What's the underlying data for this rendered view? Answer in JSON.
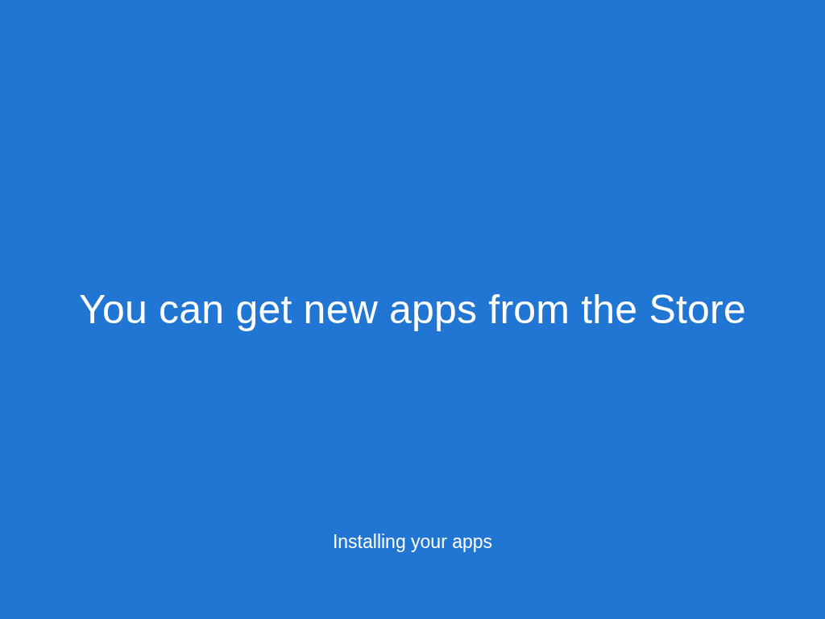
{
  "setup_screen": {
    "headline": "You can get new apps from the Store",
    "status": "Installing your apps"
  }
}
